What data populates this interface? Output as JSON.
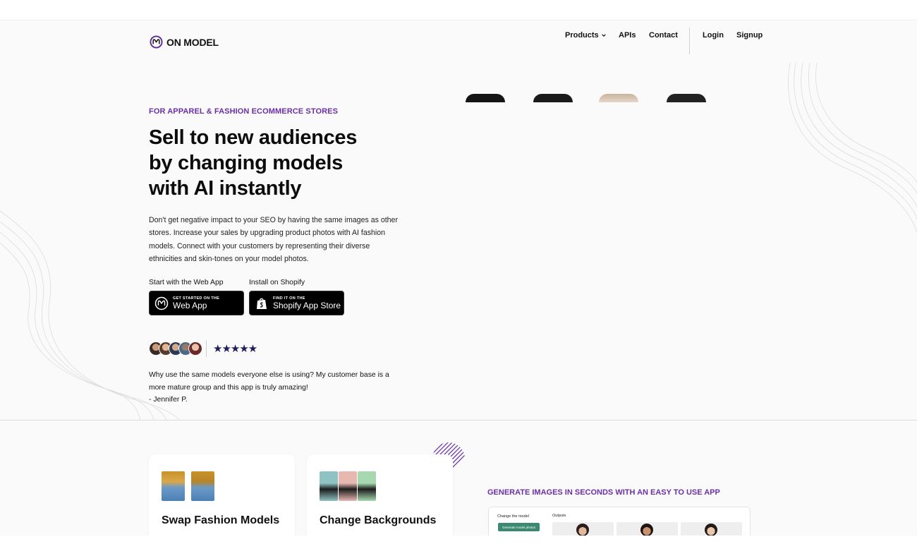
{
  "nav": {
    "logo_text": "ON MODEL",
    "products": "Products",
    "apis": "APIs",
    "contact": "Contact",
    "login": "Login",
    "signup": "Signup"
  },
  "hero": {
    "eyebrow": "FOR APPAREL & FASHION ECOMMERCE STORES",
    "headline_line1": "Sell to new audiences",
    "headline_line2": "by changing models",
    "headline_line3": "with AI instantly",
    "description": "Don't get negative impact to your SEO by having the same images as other stores. Increase your sales by upgrading product photos with AI fashion models. Connect with your customers by representing their diverse ethnicities and skin-tones on your model photos.",
    "web_cta_label": "Start with the Web App",
    "shopify_cta_label": "Install on Shopify",
    "web_button_small": "GET STARTED ON THE",
    "web_button_big": "Web App",
    "shopify_button_small": "FIND IT ON THE",
    "shopify_button_big": "Shopify App Store",
    "stars": "★★★★★",
    "rating": 5,
    "quote_line1": "Why use the same models everyone else is using? My customer base is a",
    "quote_line2": "more mature group and this app is truly amazing!",
    "quote_author": "- Jennifer P."
  },
  "features": {
    "card1_title": "Swap Fashion Models",
    "card2_title": "Change Backgrounds",
    "generate_label": "GENERATE IMAGES IN SECONDS WITH AN EASY TO USE APP",
    "app_change_model": "Change the model",
    "app_generate_button": "Generate model photos",
    "app_outputs": "Outputs"
  },
  "colors": {
    "accent_purple": "#6b2fa8",
    "star_navy": "#1c1c5e",
    "button_black": "#000000",
    "app_green": "#3b8a6f"
  },
  "icons": {
    "logo": "on-model-logo-icon",
    "chevron": "chevron-down-icon",
    "shopify": "shopify-bag-icon"
  }
}
